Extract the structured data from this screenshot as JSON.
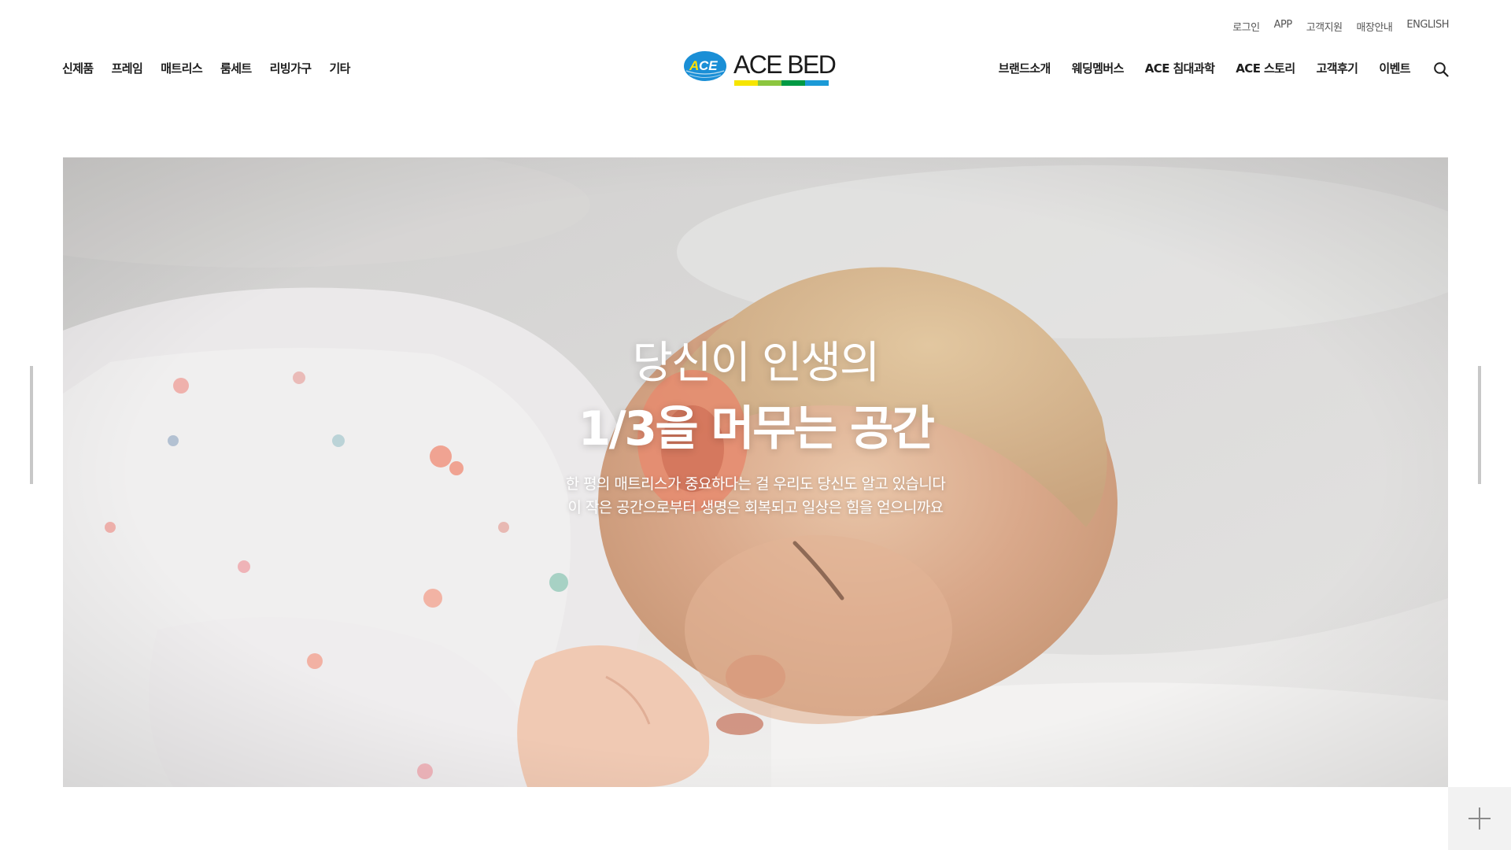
{
  "utility_nav": [
    {
      "label": "로그인"
    },
    {
      "label": "APP"
    },
    {
      "label": "고객지원"
    },
    {
      "label": "매장안내"
    },
    {
      "label": "ENGLISH"
    }
  ],
  "main_nav_left": [
    {
      "label": "신제품"
    },
    {
      "label": "프레임"
    },
    {
      "label": "매트리스"
    },
    {
      "label": "룸세트"
    },
    {
      "label": "리빙가구"
    },
    {
      "label": "기타"
    }
  ],
  "main_nav_right": [
    {
      "label": "브랜드소개"
    },
    {
      "label": "웨딩멤버스"
    },
    {
      "label": "ACE 침대과학"
    },
    {
      "label": "ACE 스토리"
    },
    {
      "label": "고객후기"
    },
    {
      "label": "이벤트"
    }
  ],
  "logo": {
    "badge_text": "ACE",
    "wordmark": "ACE BED",
    "colors": {
      "badge_blue": "#1a8fd6",
      "badge_yellow": "#ffe300",
      "stripe_1": "#f6e500",
      "stripe_2": "#8cc63f",
      "stripe_3": "#009a44",
      "stripe_4": "#1b9ad6"
    }
  },
  "hero": {
    "title_line_1": "당신이 인생의",
    "title_line_2": "1/3을 머무는 공간",
    "desc_line_1": "한 평의 매트리스가 중요하다는 걸 우리도 당신도 알고 있습니다",
    "desc_line_2": "이 작은 공간으로부터 생명은 회복되고 일상은 힘을 얻으니까요",
    "image_description_icon": "sleeping-baby-photo"
  },
  "icons": {
    "search": "search-icon",
    "plus": "plus-icon"
  }
}
